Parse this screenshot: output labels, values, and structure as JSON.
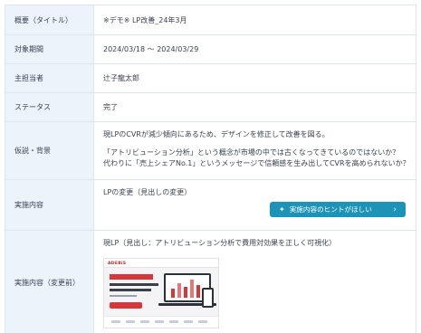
{
  "rows": [
    {
      "label": "概要（タイトル）",
      "value": "※デモ※ LP改善_24年3月"
    },
    {
      "label": "対象期間",
      "value": "2024/03/18 〜 2024/03/29"
    },
    {
      "label": "主担当者",
      "value": "辻子龍太郎"
    },
    {
      "label": "ステータス",
      "value": "完了"
    },
    {
      "label": "仮説・背景",
      "lines": [
        "現LPのCVRが減少傾向にあるため、デザインを修正して改善を図る。",
        "「アトリビューション分析」という概念が市場の中では古くなってきているのではないか？",
        "代わりに「売上シェアNo.1」というメッセージで信頼感を生み出してCVRを高められないか？"
      ]
    },
    {
      "label": "実施内容",
      "value": "LPの変更（見出しの変更）",
      "hint_button": "実施内容のヒントがほしい"
    },
    {
      "label": "実施内容（変更前）",
      "value": "現LP（見出し：アトリビューション分析で費用対効果を正しく可視化）",
      "thumbnail_logo": "ADEBiS"
    }
  ],
  "colors": {
    "label_bg": "#edf3fb",
    "accent": "#1d93b8",
    "border": "#dfe5ee"
  },
  "icons": {
    "hint": "sparkle-icon",
    "chevron": "chevron-right-icon"
  }
}
